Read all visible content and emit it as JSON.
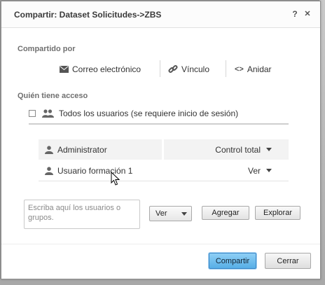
{
  "dialog": {
    "title": "Compartir: Dataset Solicitudes->ZBS",
    "help_label": "?",
    "close_label": "✕"
  },
  "shared_by": {
    "label": "Compartido por",
    "options": [
      {
        "label": "Correo electrónico",
        "icon": "envelope-icon"
      },
      {
        "label": "Vínculo",
        "icon": "link-icon"
      },
      {
        "label": "Anidar",
        "icon": "code-icon",
        "prefix": "<>"
      }
    ]
  },
  "access": {
    "label": "Quién tiene acceso",
    "everyone": {
      "label": "Todos los usuarios (se requiere inicio de sesión)",
      "checked": false,
      "icon": "users-icon"
    },
    "entries": [
      {
        "user": "Administrator",
        "permission": "Control total",
        "icon": "user-icon"
      },
      {
        "user": "Usuario formación 1",
        "permission": "Ver",
        "icon": "user-icon"
      }
    ]
  },
  "add": {
    "input_placeholder": "Escriba aquí los usuarios o grupos.",
    "input_value": "",
    "permission_value": "Ver",
    "add_button": "Agregar",
    "browse_button": "Explorar"
  },
  "footer": {
    "share_button": "Compartir",
    "close_button": "Cerrar"
  },
  "colors": {
    "primary_button": "#56aee6",
    "dialog_bg": "#ffffff",
    "backdrop": "#9b9b9b"
  }
}
